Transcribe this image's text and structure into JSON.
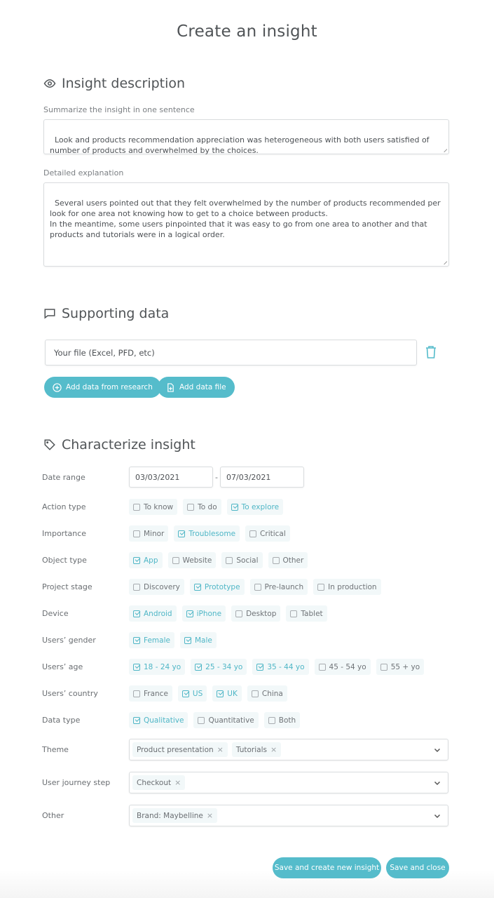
{
  "page": {
    "title": "Create an insight"
  },
  "colors": {
    "accent": "#55bccb",
    "chip_bg": "#f2f8f9",
    "text": "#505457"
  },
  "description": {
    "heading": "Insight description",
    "icon": "eye-icon",
    "summary_label": "Summarize the insight in one sentence",
    "summary_value": "Look and products recommendation appreciation was heterogeneous with both users satisfied of number of products and overwhelmed by the choices.",
    "detail_label": "Detailed explanation",
    "detail_value": "Several users pointed out that they felt overwhelmed by the number of products recommended per look for one area not knowing how to get to a choice between products.\nIn the meantime, some users pinpointed that it was easy to go from one area to another and that products and tutorials were in a logical order."
  },
  "supporting": {
    "heading": "Supporting data",
    "icon": "comment-icon",
    "file_placeholder": "Your file (Excel, PFD, etc)",
    "delete_icon": "trash-icon",
    "add_research_label": "Add data from research",
    "add_file_label": "Add data file"
  },
  "characterize": {
    "heading": "Characterize insight",
    "icon": "tag-icon",
    "date_range": {
      "label": "Date range",
      "from": "03/03/2021",
      "separator": "-",
      "to": "07/03/2021"
    },
    "rows": [
      {
        "label": "Action type",
        "options": [
          {
            "label": "To know",
            "checked": false
          },
          {
            "label": "To do",
            "checked": false
          },
          {
            "label": "To explore",
            "checked": true
          }
        ]
      },
      {
        "label": "Importance",
        "options": [
          {
            "label": "Minor",
            "checked": false
          },
          {
            "label": "Troublesome",
            "checked": true
          },
          {
            "label": "Critical",
            "checked": false
          }
        ]
      },
      {
        "label": "Object type",
        "options": [
          {
            "label": "App",
            "checked": true
          },
          {
            "label": "Website",
            "checked": false
          },
          {
            "label": "Social",
            "checked": false
          },
          {
            "label": "Other",
            "checked": false
          }
        ]
      },
      {
        "label": "Project stage",
        "options": [
          {
            "label": "Discovery",
            "checked": false
          },
          {
            "label": "Prototype",
            "checked": true
          },
          {
            "label": "Pre-launch",
            "checked": false
          },
          {
            "label": "In production",
            "checked": false
          }
        ]
      },
      {
        "label": "Device",
        "options": [
          {
            "label": "Android",
            "checked": true
          },
          {
            "label": "iPhone",
            "checked": true
          },
          {
            "label": "Desktop",
            "checked": false
          },
          {
            "label": "Tablet",
            "checked": false
          }
        ]
      },
      {
        "label": "Users’ gender",
        "options": [
          {
            "label": "Female",
            "checked": true
          },
          {
            "label": "Male",
            "checked": true
          }
        ]
      },
      {
        "label": "Users’ age",
        "options": [
          {
            "label": "18 - 24 yo",
            "checked": true
          },
          {
            "label": "25 - 34 yo",
            "checked": true
          },
          {
            "label": "35 - 44 yo",
            "checked": true
          },
          {
            "label": "45 - 54 yo",
            "checked": false
          },
          {
            "label": "55 + yo",
            "checked": false
          }
        ]
      },
      {
        "label": "Users’ country",
        "options": [
          {
            "label": "France",
            "checked": false
          },
          {
            "label": "US",
            "checked": true
          },
          {
            "label": "UK",
            "checked": true
          },
          {
            "label": "China",
            "checked": false
          }
        ]
      },
      {
        "label": "Data type",
        "options": [
          {
            "label": "Qualitative",
            "checked": true
          },
          {
            "label": "Quantitative",
            "checked": false
          },
          {
            "label": "Both",
            "checked": false
          }
        ]
      }
    ],
    "selects": [
      {
        "label": "Theme",
        "tags": [
          "Product presentation",
          "Tutorials"
        ]
      },
      {
        "label": "User journey step",
        "tags": [
          "Checkout"
        ]
      },
      {
        "label": "Other",
        "tags": [
          "Brand: Maybelline"
        ]
      }
    ]
  },
  "footer": {
    "save_new_label": "Save and create new insight",
    "save_close_label": "Save and close"
  }
}
